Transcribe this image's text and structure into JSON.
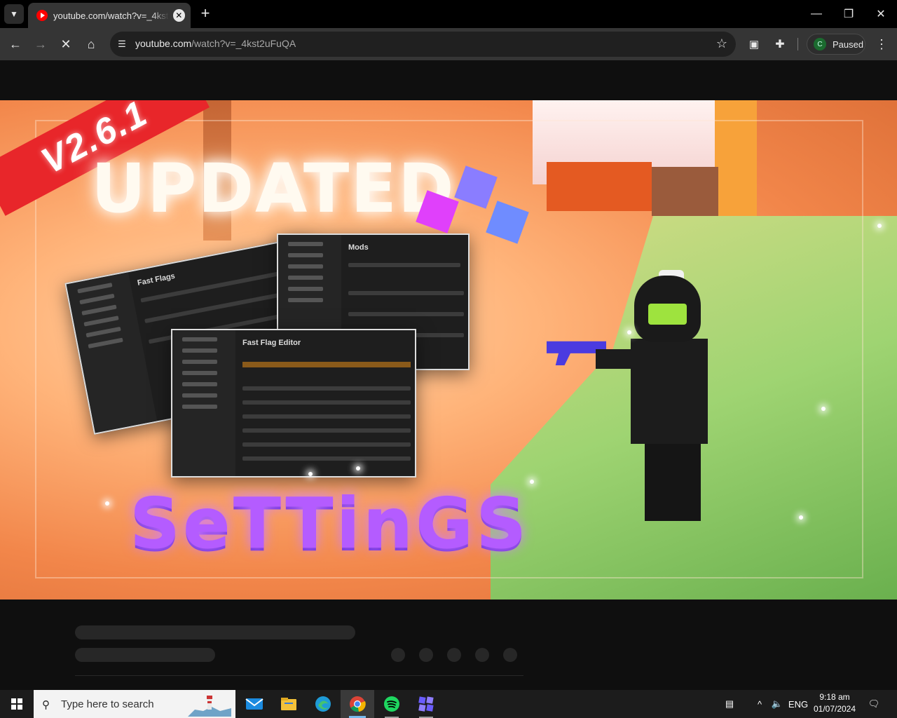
{
  "browser": {
    "tab_title": "youtube.com/watch?v=_4kst2uFuQA",
    "url_host": "youtube.com",
    "url_path": "/watch?v=_4kst2uFuQA",
    "profile_initial": "C",
    "profile_status": "Paused"
  },
  "thumbnail": {
    "version_badge": "V2.6.1",
    "headline": "UPDATED",
    "subline": "SeTTinGS",
    "panel_titles": [
      "Fast Flags",
      "Mods",
      "Fast Flag Editor"
    ]
  },
  "taskbar": {
    "search_placeholder": "Type here to search",
    "apps": [
      "mail-icon",
      "file-explorer-icon",
      "edge-icon",
      "chrome-icon",
      "spotify-icon",
      "roblox-studio-icon"
    ],
    "language": "ENG",
    "time": "9:18 am",
    "date": "01/07/2024"
  }
}
